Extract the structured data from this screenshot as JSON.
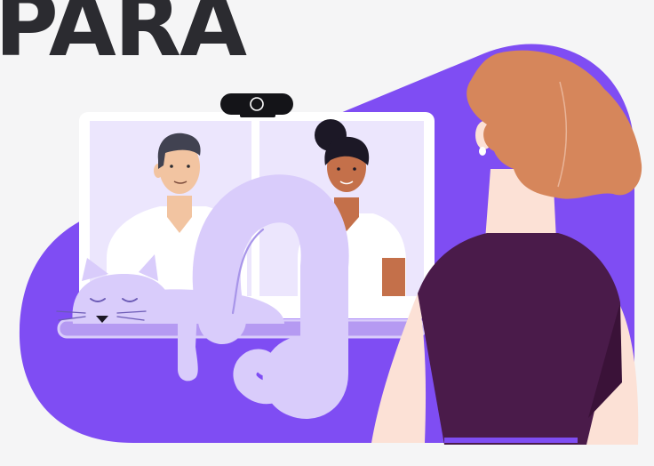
{
  "headline": "PARA",
  "colors": {
    "background": "#f5f5f6",
    "headline": "#2b2b30",
    "blob": "#7f4df3",
    "shelf": "#b59af2",
    "monitor_frame": "#ffffff",
    "screen": "#ece6fd",
    "cat": "#d9ccfb",
    "cat_outline": "#a895e9",
    "man_skin": "#f2c4a1",
    "man_hair": "#414251",
    "woman_skin": "#c4704a",
    "woman_hair": "#1c1826",
    "viewer_hair": "#d6865b",
    "viewer_skin": "#fce1d6",
    "viewer_top": "#4a1b4a"
  },
  "icons": [
    "webcam-icon"
  ]
}
